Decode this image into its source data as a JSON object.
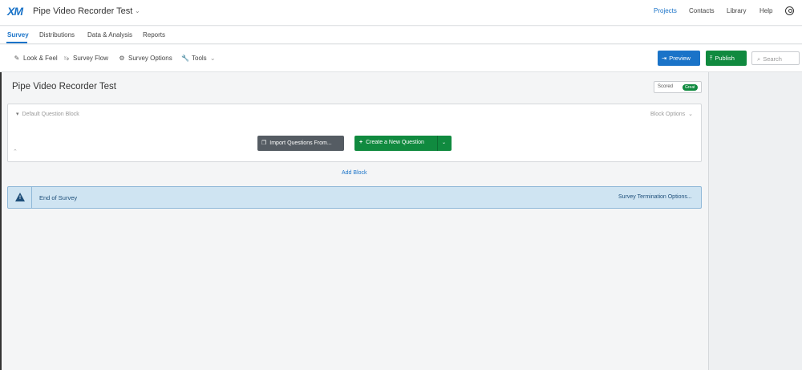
{
  "topbar": {
    "logo": "XM",
    "project_title": "Pipe Video Recorder Test",
    "caret": "⌄",
    "nav": {
      "projects": "Projects",
      "contacts": "Contacts",
      "library": "Library",
      "help": "Help"
    }
  },
  "tabs": {
    "survey": "Survey",
    "distributions": "Distributions",
    "data_analysis": "Data & Analysis",
    "reports": "Reports"
  },
  "toolbar": {
    "look_feel": "Look & Feel",
    "survey_flow": "Survey Flow",
    "survey_options": "Survey Options",
    "tools": "Tools",
    "preview": "Preview",
    "publish": "Publish",
    "search_placeholder": "Search"
  },
  "survey": {
    "title": "Pipe Video Recorder Test",
    "scored_label": "Scored",
    "scored_badge": "Great"
  },
  "block": {
    "name": "Default Question Block",
    "options": "Block Options",
    "import_label": "Import Questions From...",
    "create_label": "Create a New Question",
    "add_block": "Add Block"
  },
  "end_of_survey": {
    "label": "End of Survey",
    "options": "Survey Termination Options..."
  },
  "colors": {
    "accent_blue": "#1a73c8",
    "publish_green": "#108a3f",
    "import_gray": "#555c63",
    "eos_bg": "#cfe4f2"
  }
}
